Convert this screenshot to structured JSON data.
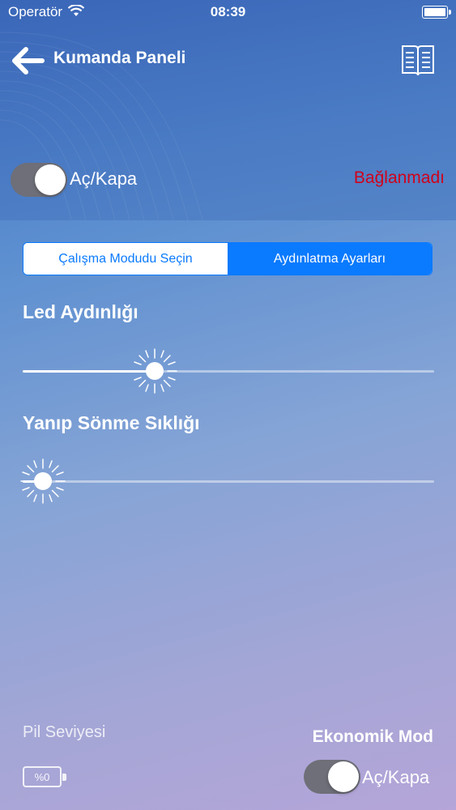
{
  "status_bar": {
    "carrier": "Operatör",
    "time": "08:39"
  },
  "nav": {
    "title": "Kumanda Paneli",
    "back_icon": "arrow-left-icon",
    "manual_icon": "book-icon"
  },
  "power": {
    "label": "Aç/Kapa",
    "on": true
  },
  "connection": {
    "status": "Bağlanmadı",
    "color": "#d0021b"
  },
  "segments": {
    "items": [
      "Çalışma Modudu Seçin",
      "Aydınlatma Ayarları"
    ],
    "selected": 1,
    "accent": "#0a7aff"
  },
  "led": {
    "title": "Led Aydınlığı",
    "value": 0.32
  },
  "blink": {
    "title": "Yanıp Sönme Sıklığı",
    "value": 0.05
  },
  "battery": {
    "label": "Pil Seviyesi",
    "percent": "%0"
  },
  "eco": {
    "title": "Ekonomik Mod",
    "label": "Aç/Kapa",
    "on": true
  }
}
